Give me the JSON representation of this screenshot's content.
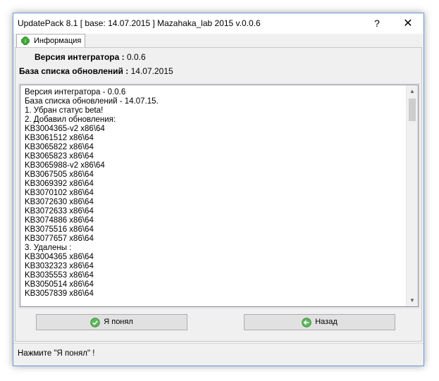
{
  "window": {
    "title": "UpdatePack 8.1 [ base: 14.07.2015 ] Mazahaka_lab 2015 v.0.0.6",
    "help_label": "?",
    "close_label": "✕"
  },
  "tabs": [
    {
      "label": "Информация",
      "icon": "info-icon",
      "active": true
    }
  ],
  "info": {
    "integrator_version_label": "Версия интегратора :",
    "integrator_version_value": "0.0.6",
    "db_label": "База списка обновлений :",
    "db_value": "14.07.2015"
  },
  "log": {
    "lines": [
      "Версия интегратора - 0.0.6",
      "База списка обновлений - 14.07.15.",
      "1. Убран статус beta!",
      "2. Добавил обновления:",
      "KB3004365-v2 x86\\64",
      "KB3061512 x86\\64",
      "KB3065822 x86\\64",
      "KB3065823 x86\\64",
      "KB3065988-v2 x86\\64",
      "KB3067505 x86\\64",
      "KB3069392 x86\\64",
      "KB3070102 x86\\64",
      "KB3072630 x86\\64",
      "KB3072633 x86\\64",
      "KB3074886 x86\\64",
      "KB3075516 x86\\64",
      "KB3077657 x86\\64",
      "3. Удалены :",
      "KB3004365 x86\\64",
      "KB3032323 x86\\64",
      "KB3035553 x86\\64",
      "KB3050514 x86\\64",
      "KB3057839 x86\\64"
    ]
  },
  "buttons": {
    "ok_label": "Я понял",
    "back_label": "Назад"
  },
  "status": {
    "text": "Нажмите \"Я понял\" !"
  },
  "colors": {
    "accent_green": "#3fa83a",
    "window_border": "#6a9bd5"
  }
}
